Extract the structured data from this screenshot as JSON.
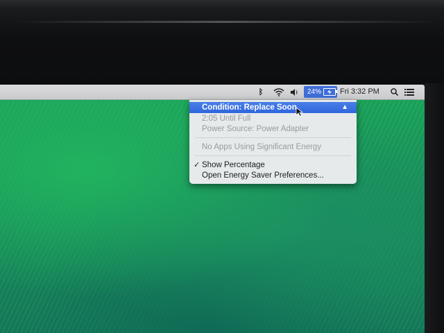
{
  "menubar": {
    "icons": [
      "bluetooth-icon",
      "wifi-icon",
      "volume-icon",
      "battery-icon",
      "search-icon",
      "list-icon"
    ],
    "battery_percent": "24%",
    "clock": "Fri 3:32 PM",
    "colors": {
      "battery_highlight": "#3f6ed8",
      "menubar": "#d2d3d5"
    }
  },
  "battery_menu": {
    "condition": "Condition: Replace Soon",
    "time_until_full": "2:05 Until Full",
    "power_source": "Power Source: Power Adapter",
    "energy_apps": "No Apps Using Significant Energy",
    "show_percentage": "Show Percentage",
    "show_percentage_checked": true,
    "open_prefs": "Open Energy Saver Preferences...",
    "colors": {
      "highlight": "#2f66dc"
    }
  }
}
